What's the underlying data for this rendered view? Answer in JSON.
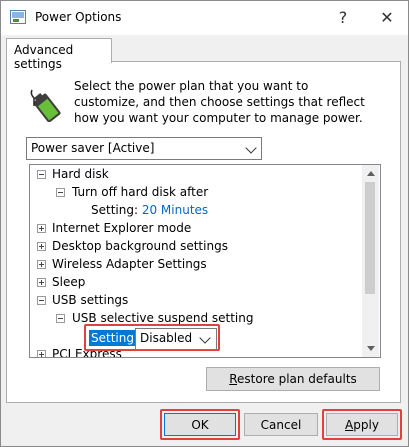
{
  "window": {
    "title": "Power Options",
    "help_glyph": "?",
    "close_glyph": "✕",
    "icon": "power-options-icon"
  },
  "tab": {
    "label": "Advanced settings"
  },
  "description": "Select the power plan that you want to customize, and then choose settings that reflect how you want your computer to manage power.",
  "plan": {
    "selected": "Power saver [Active]"
  },
  "tree": {
    "items": [
      {
        "label": "Hard disk",
        "expanded": true
      },
      {
        "label": "Turn off hard disk after",
        "expanded": true
      },
      {
        "setting_prefix": "Setting:",
        "setting_value": "20 Minutes"
      },
      {
        "label": "Internet Explorer mode",
        "expanded": false
      },
      {
        "label": "Desktop background settings",
        "expanded": false
      },
      {
        "label": "Wireless Adapter Settings",
        "expanded": false
      },
      {
        "label": "Sleep",
        "expanded": false
      },
      {
        "label": "USB settings",
        "expanded": true
      },
      {
        "label": "USB selective suspend setting",
        "expanded": true
      },
      {
        "setting_prefix": "Setting:",
        "setting_value": "Disabled"
      },
      {
        "label": "PCI Express",
        "expanded": false
      }
    ]
  },
  "buttons": {
    "restore_prefix": "R",
    "restore_rest": "estore plan defaults",
    "ok": "OK",
    "cancel": "Cancel",
    "apply_prefix": "A",
    "apply_rest": "pply"
  },
  "colors": {
    "highlight_border": "#e0413e",
    "selection_blue": "#0078d7",
    "link_blue": "#0066cc"
  }
}
